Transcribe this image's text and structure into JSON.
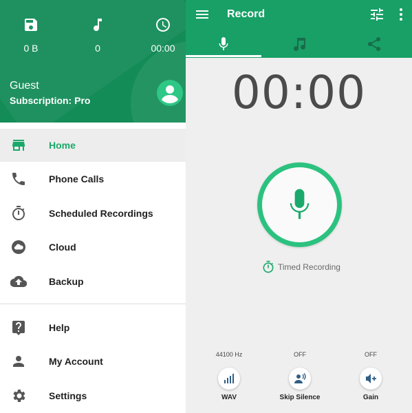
{
  "drawer": {
    "stats": {
      "storage": {
        "icon": "save-icon",
        "value": "0 B"
      },
      "recordings": {
        "icon": "music-note-icon",
        "value": "0"
      },
      "duration": {
        "icon": "clock-icon",
        "value": "00:00"
      }
    },
    "user": {
      "name": "Guest",
      "subscription": "Subscription: Pro",
      "avatar_icon": "account-circle-icon"
    },
    "items": [
      {
        "label": "Home",
        "icon": "store-icon",
        "active": true
      },
      {
        "label": "Phone Calls",
        "icon": "phone-icon",
        "active": false
      },
      {
        "label": "Scheduled Recordings",
        "icon": "timer-icon",
        "active": false
      },
      {
        "label": "Cloud",
        "icon": "cloud-icon",
        "active": false
      },
      {
        "label": "Backup",
        "icon": "cloud-upload-icon",
        "active": false
      },
      {
        "label": "Help",
        "icon": "help-icon",
        "active": false
      },
      {
        "label": "My Account",
        "icon": "person-icon",
        "active": false
      },
      {
        "label": "Settings",
        "icon": "gear-icon",
        "active": false
      }
    ]
  },
  "topbar": {
    "title": "Record",
    "menu_icon": "hamburger-menu-icon",
    "tune_icon": "tune-icon",
    "more_icon": "more-vert-icon",
    "tabs": [
      {
        "icon": "mic-icon",
        "active": true
      },
      {
        "icon": "music-note-icon",
        "active": false
      },
      {
        "icon": "share-icon",
        "active": false
      }
    ]
  },
  "recorder": {
    "timer": "00:00",
    "record_icon": "mic-icon",
    "timed_recording_label": "Timed Recording",
    "options": [
      {
        "top": "44100 Hz",
        "label": "WAV",
        "icon": "signal-bars-icon"
      },
      {
        "top": "OFF",
        "label": "Skip Silence",
        "icon": "skip-silence-icon"
      },
      {
        "top": "OFF",
        "label": "Gain",
        "icon": "volume-plus-icon"
      }
    ]
  },
  "colors": {
    "drawer_header": "#148c58",
    "toolbar": "#18a067",
    "accent": "#1aa96a",
    "record_ring": "#2bc27f"
  }
}
